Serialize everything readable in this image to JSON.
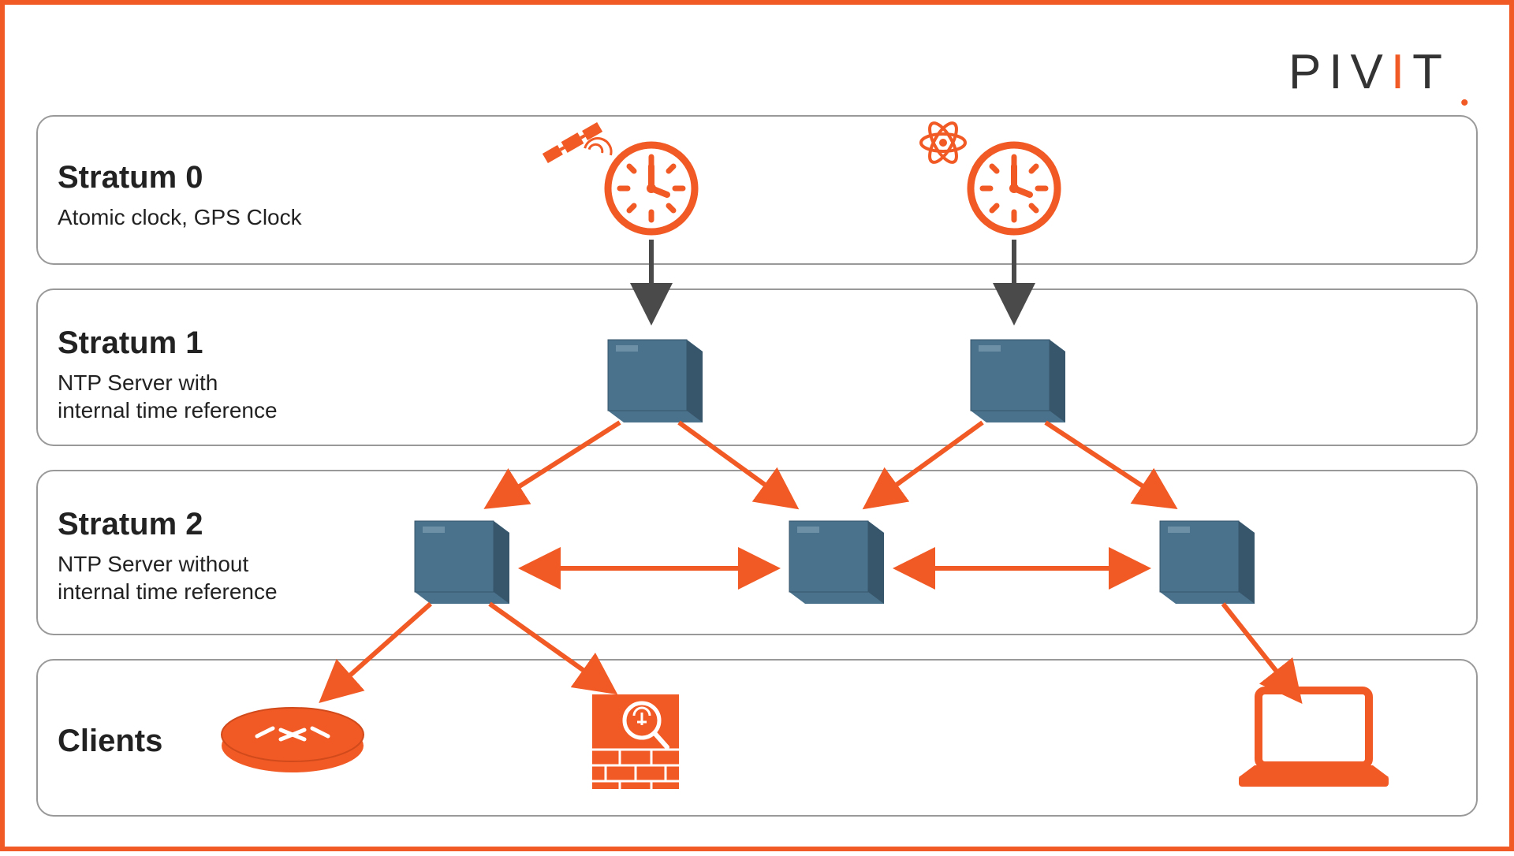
{
  "brand": {
    "p1": "PIV",
    "accent": "I",
    "p2": "T"
  },
  "strata": [
    {
      "title": "Stratum 0",
      "subtitle": "Atomic clock, GPS Clock"
    },
    {
      "title": "Stratum 1",
      "subtitle": "NTP Server with\ninternal time reference"
    },
    {
      "title": "Stratum 2",
      "subtitle": "NTP Server without\ninternal time reference"
    },
    {
      "title": "Clients",
      "subtitle": ""
    }
  ],
  "colors": {
    "orange": "#f15a24",
    "grey": "#4a4a4a",
    "serverFill": "#4a728c",
    "serverDark": "#37566b",
    "serverTop": "#6e90a6"
  }
}
